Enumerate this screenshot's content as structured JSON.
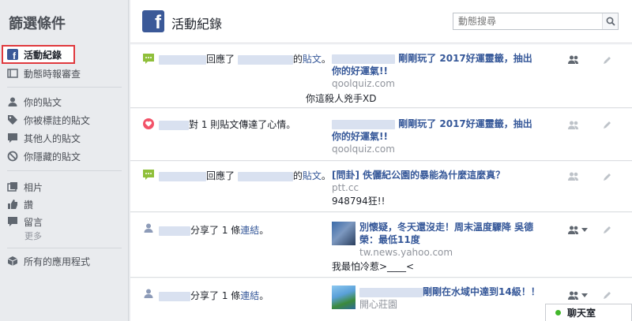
{
  "sidebar": {
    "title": "篩選條件",
    "items": [
      {
        "label": "活動紀錄",
        "icon": "facebook-icon"
      },
      {
        "label": "動態時報審查",
        "icon": "timeline-review-icon"
      },
      {
        "label": "你的貼文",
        "icon": "person-icon"
      },
      {
        "label": "你被標註的貼文",
        "icon": "tag-icon"
      },
      {
        "label": "其他人的貼文",
        "icon": "comment-icon"
      },
      {
        "label": "你隱藏的貼文",
        "icon": "hidden-icon"
      },
      {
        "label": "相片",
        "icon": "photo-icon"
      },
      {
        "label": "讚",
        "icon": "like-icon"
      },
      {
        "label": "留言",
        "icon": "speech-bubble-icon"
      },
      {
        "label": "更多"
      },
      {
        "label": "所有的應用程式",
        "icon": "apps-cube-icon"
      }
    ]
  },
  "header": {
    "title": "活動紀錄",
    "search_placeholder": "動態搜尋"
  },
  "rows": [
    {
      "pre": "回應了",
      "post": "的",
      "link": "貼文",
      "tail": "。",
      "attach_title_1": "剛剛玩了 2017好運靈籤，抽出",
      "attach_title_2": "你的好運氣!!",
      "domain": "qoolquiz.com",
      "comment": "你這殺人兇手XD"
    },
    {
      "text": "對 1 則貼文傳達了心情。",
      "attach_title_1": "剛剛玩了 2017好運靈籤，抽出",
      "attach_title_2": "你的好運氣!!",
      "domain": "qoolquiz.com"
    },
    {
      "pre": "回應了",
      "post": "的",
      "link": "貼文",
      "tail": "。",
      "attach_title_1": "[問卦] 佚儷紀公園的暴能為什麼這麼真？",
      "domain": "ptt.cc",
      "comment": "948794狂!!"
    },
    {
      "pre": "分享了 1 條",
      "link": "連結",
      "tail": "。",
      "attach_title_1": "別懷疑，冬天還沒走！周末溫度驟降 吳德",
      "attach_title_2": "榮：最低11度",
      "domain": "tw.news.yahoo.com",
      "comment": "我最怕冷惹>____<"
    },
    {
      "pre": "分享了 1 條",
      "link": "連結",
      "tail": "。",
      "attach_title_1": "剛剛在水域中達到14級！！",
      "domain": "開心莊園"
    }
  ],
  "chat": {
    "label": "聊天室"
  }
}
